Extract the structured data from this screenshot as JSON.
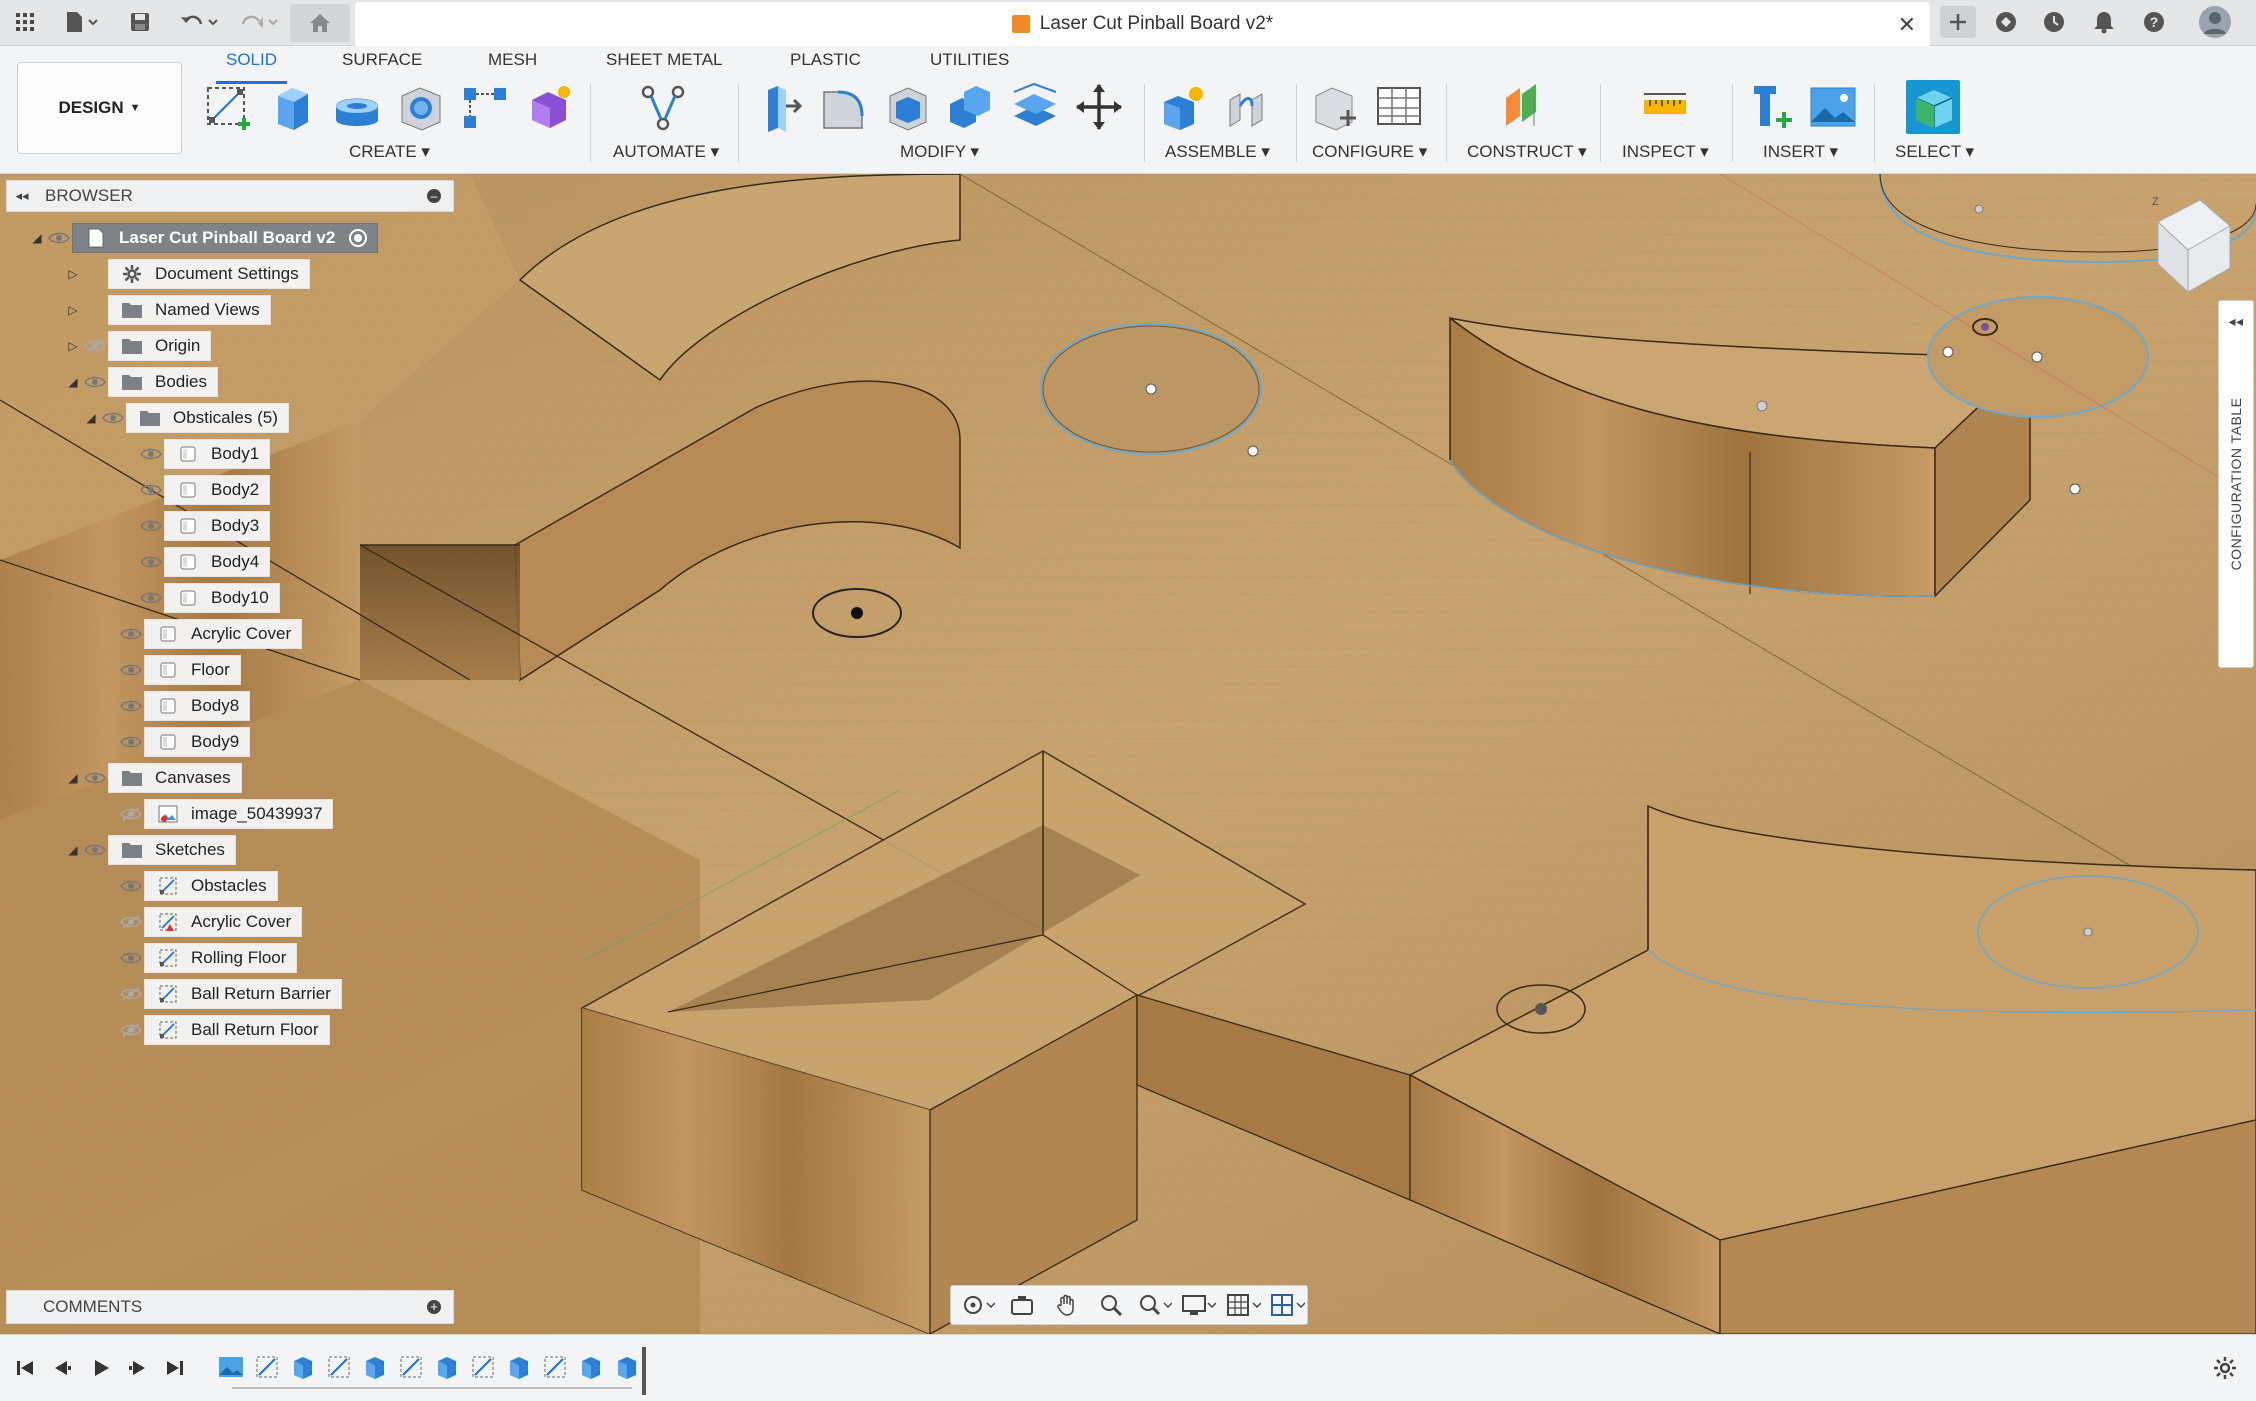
{
  "titlebar": {
    "document_title": "Laser Cut Pinball Board v2*",
    "icons": [
      "grid-menu-icon",
      "file-icon",
      "save-icon",
      "undo-icon",
      "redo-icon",
      "home-icon",
      "close-icon",
      "new-tab-icon",
      "extensions-icon",
      "clock-icon",
      "bell-icon",
      "help-icon",
      "user-avatar-icon"
    ]
  },
  "ribbon": {
    "workspace": "DESIGN",
    "tabs": [
      "SOLID",
      "SURFACE",
      "MESH",
      "SHEET METAL",
      "PLASTIC",
      "UTILITIES"
    ],
    "active_tab": "SOLID",
    "groups": [
      "CREATE",
      "AUTOMATE",
      "MODIFY",
      "ASSEMBLE",
      "CONFIGURE",
      "CONSTRUCT",
      "INSPECT",
      "INSERT",
      "SELECT"
    ]
  },
  "browser": {
    "title": "BROWSER",
    "root": "Laser Cut Pinball Board v2",
    "items": [
      {
        "label": "Document Settings"
      },
      {
        "label": "Named Views"
      },
      {
        "label": "Origin"
      },
      {
        "label": "Bodies"
      },
      {
        "label": "Obsticales (5)"
      },
      {
        "label": "Body1"
      },
      {
        "label": "Body2"
      },
      {
        "label": "Body3"
      },
      {
        "label": "Body4"
      },
      {
        "label": "Body10"
      },
      {
        "label": "Acrylic Cover"
      },
      {
        "label": "Floor"
      },
      {
        "label": "Body8"
      },
      {
        "label": "Body9"
      },
      {
        "label": "Canvases"
      },
      {
        "label": "image_50439937"
      },
      {
        "label": "Sketches"
      },
      {
        "label": "Obstacles"
      },
      {
        "label": "Acrylic Cover"
      },
      {
        "label": "Rolling Floor"
      },
      {
        "label": "Ball Return Barrier"
      },
      {
        "label": "Ball Return Floor"
      }
    ]
  },
  "comments": {
    "title": "COMMENTS"
  },
  "config_panel": {
    "label": "CONFIGURATION TABLE"
  },
  "colors": {
    "accent": "#1a73d8",
    "wood": "#c29a63",
    "wood_dark": "#8a6535",
    "sketch_line": "#6fa8c8"
  }
}
